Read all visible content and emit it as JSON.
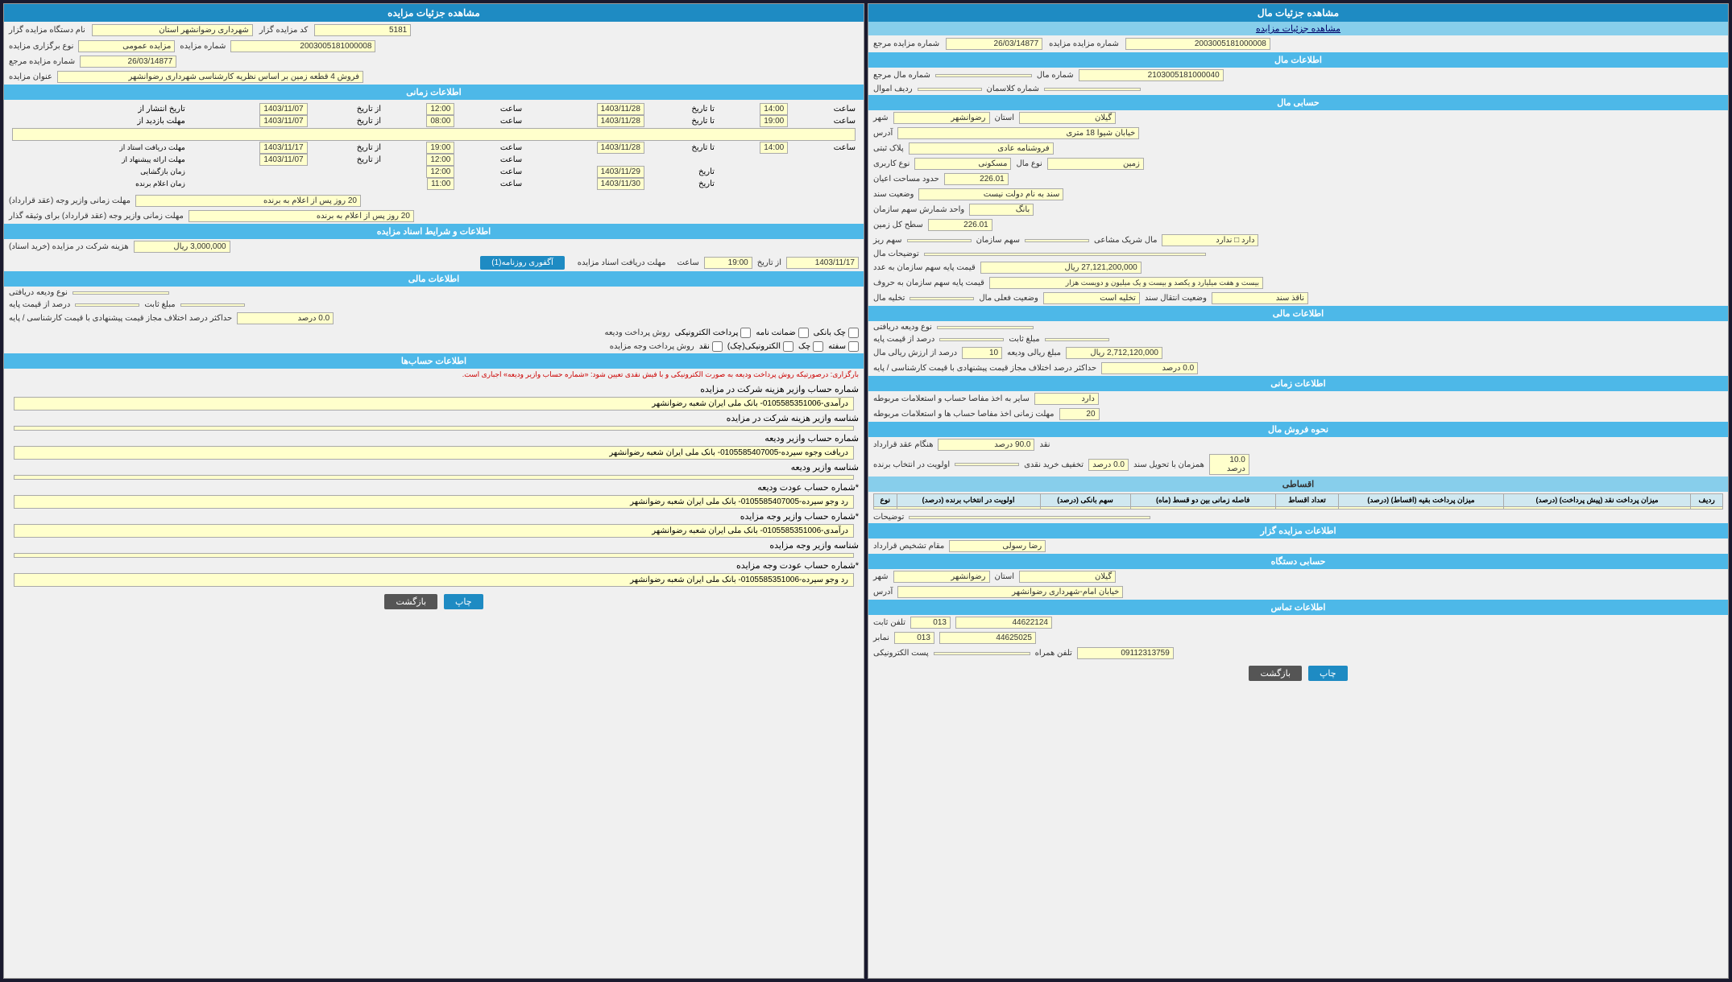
{
  "left_panel": {
    "main_header": "مشاهده جزئیات مال",
    "sub_link": "مشاهده جزئیات مزایده",
    "auction_number_label": "شماره مزایده مزایده",
    "auction_number_value": "2003005181000008",
    "reference_number_label": "شماره مزایده مرجع",
    "reference_number_value": "26/03/14877",
    "financial_info_header": "اطلاعات مال",
    "mal_number_label": "شماره مال",
    "mal_number_value": "2103005181000040",
    "mal_marje_label": "شماره مال مرجع",
    "mal_marje_value": "",
    "classman_label": "شماره کلاسمان",
    "classman_value": "",
    "amval_label": "ردیف اموال",
    "amval_value": "",
    "hesabi_header": "حسابی مال",
    "ostan_label": "استان",
    "ostan_value": "گیلان",
    "shahr_label": "شهر",
    "shahr_value": "رضوانشهر",
    "address_label": "آدرس",
    "address_value": "خیابان شیوا 18 متری",
    "plak_label": "پلاک ثبتی",
    "plak_value": "فروشنامه عادی",
    "noe_label": "نوع مال",
    "noe_value": "زمین",
    "karabri_label": "نوع کاربری",
    "karabri_value": "مسکونی",
    "mosaha_label": "حدود مساحت اعیان",
    "mosaha_value": "226.01",
    "vaziat_label": "وضعیت سند",
    "vaziat_value": "سند به نام دولت نیست",
    "share_label": "واحد شمارش سهم سازمان",
    "share_value": "بانگ",
    "satr_label": "سطح کل زمین",
    "satr_value": "226.01",
    "sharik_label": "مال شریک مشاعی",
    "sharik_value": "دارد □ ندارد",
    "sahm_sazman_label": "سهم سازمان",
    "sahm_sazman_value": "",
    "sahm_riz_label": "سهم ریز",
    "sahm_riz_value": "",
    "towzih_label": "توضیحات مال",
    "towzih_value": "",
    "price_base_label": "قیمت پایه سهم سازمان به عدد",
    "price_base_value": "27,121,200,000 ریال",
    "price_base_text_label": "قیمت پایه سهم سازمان به حروف",
    "price_base_text_value": "بیست و هفت میلیارد و یکصد و بیست و یک میلیون و دویست هزار",
    "vaziat_sanad_label": "وضعیت انتقال سند",
    "vaziat_sanad_value": "ناقذ سند",
    "vaziat_feli_label": "وضعیت فعلی مال",
    "vaziat_feli_value": "تخلیه است",
    "takhlie_label": "تخلیه مال",
    "takhlie_value": "",
    "financial_header": "اطلاعات مالی",
    "noe_vodie_label": "نوع ودیعه دریافتی",
    "noe_vodie_value": "",
    "mablag_label": "مبلغ ثابت",
    "mablag_value": "",
    "mablag_rial_label": "مبلغ ریالی ودیعه",
    "mablag_rial_value": "2,712,120,000 ریال",
    "darsad_ghimat_label": "درصد از قیمت پایه",
    "darsad_ghimat_value": "",
    "darsad_arzesh_label": "درصد از ارزش ریالی مال",
    "darsad_arzesh_value": "10",
    "hadasghar_label": "حداکثر درصد اختلاف مجاز قیمت پیشنهادی با قیمت کارشناسی / پایه",
    "hadasghar_value": "0.0 درصد",
    "zamani_header": "اطلاعات زمانی",
    "baraye_hesab_label": "سایر به اخذ مفاصا حساب و استعلامات مربوطه",
    "baraye_hesab_value": "دارد",
    "mohl_label": "مهلت زمانی اخذ مفاصا حساب ها و استعلامات مربوطه",
    "mohl_value": "20",
    "foroosh_header": "نحوه فروش مال",
    "naqd_label": "نقد",
    "naqd_value": "",
    "hanqam_aqd_label": "هنگام عقد قرارداد",
    "hanqam_aqd_value": "90.0 درصد",
    "hamzaman_label": "همزمان با تحویل سند",
    "hamzaman_value": "10.0 درصد",
    "kharid_naqd_label": "تخفیف خرید نقدی",
    "kharid_naqd_value": "0.0 درصد",
    "avvaliat_label": "اولویت در انتخاب برنده",
    "avvaliat_value": "",
    "eqsat_label": "اقساطی",
    "table_headers": [
      "ردیف",
      "میزان پرداخت نقد (پیش پرداخت) (درصد)",
      "میزان پرداخت بقیه (افساط) (درصد)",
      "تعداد اقساط",
      "فاصله زمانی بین دو قسط (ماه)",
      "سهم بانکی (درصد)",
      "اولویت در انتخاب برنده (درصد)",
      "نوع"
    ],
    "towzih_table_label": "توضیحات",
    "towzih_table_value": "",
    "gabr_header": "اطلاعات مزایده گزار",
    "moqam_label": "مقام تشخیص قرارداد",
    "moqam_value": "رضا رسولی",
    "nasabi_header": "حسابی دستگاه",
    "ostan_nasabi_label": "استان",
    "ostan_nasabi_value": "گیلان",
    "shahr_nasabi_label": "شهر",
    "shahr_nasabi_value": "رضوانشهر",
    "address_nasabi_label": "آدرس",
    "address_nasabi_value": "خیابان امام-شهرداری رضوانشهر",
    "tamas_header": "اطلاعات تماس",
    "tel_sabit_label": "تلفن ثابت",
    "tel_sabit_value": "44622124",
    "tel_sabit_code": "013",
    "fax_label": "نمابر",
    "fax_value": "44625025",
    "fax_code": "013",
    "tel_hamrah_label": "تلفن همراه",
    "tel_hamrah_value": "09112313759",
    "email_label": "پست الکترونیکی",
    "email_value": "",
    "btn_print": "چاپ",
    "btn_back": "بازگشت"
  },
  "right_panel": {
    "main_header": "مشاهده جزئیات مزایده",
    "auction_code_label": "کد مزایده گزار",
    "auction_code_value": "5181",
    "auction_name_label": "نام دستگاه مزایده گزار",
    "auction_name_value": "شهرداری رضوانشهر استان",
    "noe_label": "نوع برگزاری مزایده",
    "noe_value": "مزایده عمومی",
    "number_label": "شماره مزایده",
    "number_value": "2003005181000008",
    "marje_label": "شماره مزایده مرجع",
    "marje_value": "26/03/14877",
    "onvan_label": "عنوان مزایده",
    "onvan_value": "فروش 4 قطعه زمین بر اساس نظریه کارشناسی شهرداری رضوانشهر",
    "zamani_header": "اطلاعات زمانی",
    "enteshar_az_label": "تاریخ انتشار از",
    "enteshar_az_date": "1403/11/07",
    "enteshar_az_time": "12:00",
    "enteshar_ta_label": "تا تاریخ",
    "enteshar_ta_date": "1403/11/28",
    "enteshar_ta_time": "14:00",
    "bazia_az_label": "مهلت بازدید از",
    "bazia_az_date": "1403/11/07",
    "bazia_az_time": "08:00",
    "bazia_ta_date": "1403/11/28",
    "bazia_ta_time": "19:00",
    "towzih_az_label": "توضیحات",
    "mohl_estad_az_label": "مهلت دریافت استاد از",
    "mohl_estad_az_date": "1403/11/17",
    "mohl_estad_az_time": "19:00",
    "mohl_estad_ta_date": "1403/11/28",
    "mohl_estad_ta_time": "14:00",
    "mohl_pishnahad_az_label": "مهلت ارائه پیشنهاد از",
    "mohl_pishnahad_az_date": "1403/11/07",
    "mohl_pishnahad_az_time": "12:00",
    "bazgoshai_label": "زمان بازگشایی",
    "bazgoshai_date": "1403/11/29",
    "bazgoshai_time": "12:00",
    "elam_label": "زمان اعلام برنده",
    "elam_date": "1403/11/30",
    "elam_time": "11:00",
    "mohl_variz_label": "مهلت زمانی وازیر وجه (عقد قرارداد)",
    "mohl_variz_value": "20 روز پس از اعلام به برنده",
    "mohl_variz2_label": "مهلت زمانی وازیر وجه (عقد قرارداد) برای وثیقه گذار",
    "mohl_variz2_value": "20 روز پس از اعلام به برنده",
    "asnad_header": "اطلاعات و شرایط اسناد مزایده",
    "hoghooq_label": "هزینه شرکت در مزایده (خرید اسناد)",
    "hoghooq_value": "3,000,000 ریال",
    "mohl_asnad_az_label": "مهلت دریافت اسناد مزایده",
    "mohl_asnad_az_date": "1403/11/17",
    "mohl_asnad_az_time": "19:00",
    "akfori_label": "آگفوری روزنامه(1)",
    "mabna_header": "اطلاعات مالی",
    "noe_vodie_label": "نوع ودیعه دریافتی",
    "mablag_sabt_label": "مبلغ ثابت",
    "darsad_az_label": "درصد از قیمت پایه",
    "hadasghar_label": "حداکثر درصد اختلاف مجاز قیمت پیشنهادی با قیمت کارشناسی / پایه",
    "hadasghar_value": "0.0 درصد",
    "roos_label": "روش پرداخت ودیعه",
    "payment_options": [
      "پرداخت الکترونیکی",
      "ضمانت نامه",
      "چک بانکی"
    ],
    "roos_variz_label": "روش پرداخت وجه مزایده",
    "payment2_options": [
      "نقد",
      "الکترونیکی(چک)",
      "چک",
      "سفته"
    ],
    "hesabha_header": "اطلاعات حساب‌ها",
    "info_red": "بارگزاری: درصورتیکه روش پرداخت ودیعه به صورت الکترونیکی و با فیش نقدی تعیین شود: «شماره حساب وازیر ودیعه» اجباری است.",
    "account1_label": "شماره حساب وازیر هزینه شرکت در مزایده",
    "account1_value": "درآمدی-0105585351006- بانک ملی ایران شعبه رضوانشهر",
    "sanadi1_label": "شناسه وازیر هزینه شرکت در مزایده",
    "account2_label": "شماره حساب وازیر ودیعه",
    "account2_value": "دریافت وجوه سیرده-0105585407005- بانک ملی ایران شعبه رضوانشهر",
    "sanadi2_label": "شناسه وازیر ودیعه",
    "account3_label": "*شماره حساب عودت ودیعه",
    "account3_value": "رد وجو سیرده-0105585407005- بانک ملی ایران شعبه رضوانشهر",
    "account4_label": "*شماره حساب وازیر وجه مزایده",
    "account4_value": "درآمدی-0105585351006- بانک ملی ایران شعبه رضوانشهر",
    "sanadi4_label": "شناسه وازیر وجه مزایده",
    "account5_label": "*شماره حساب عودت وجه مزایده",
    "account5_value": "رد وجو سیرده-0105585351006- بانک ملی ایران شعبه رضوانشهر",
    "btn_print": "چاپ",
    "btn_back": "بازگشت"
  }
}
